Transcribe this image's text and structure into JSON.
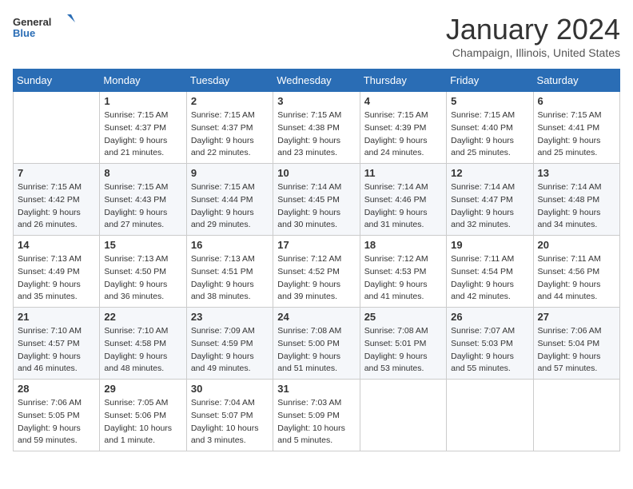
{
  "logo": {
    "general": "General",
    "blue": "Blue"
  },
  "title": "January 2024",
  "location": "Champaign, Illinois, United States",
  "headers": [
    "Sunday",
    "Monday",
    "Tuesday",
    "Wednesday",
    "Thursday",
    "Friday",
    "Saturday"
  ],
  "weeks": [
    [
      {
        "day": "",
        "sunrise": "",
        "sunset": "",
        "daylight": ""
      },
      {
        "day": "1",
        "sunrise": "Sunrise: 7:15 AM",
        "sunset": "Sunset: 4:37 PM",
        "daylight": "Daylight: 9 hours and 21 minutes."
      },
      {
        "day": "2",
        "sunrise": "Sunrise: 7:15 AM",
        "sunset": "Sunset: 4:37 PM",
        "daylight": "Daylight: 9 hours and 22 minutes."
      },
      {
        "day": "3",
        "sunrise": "Sunrise: 7:15 AM",
        "sunset": "Sunset: 4:38 PM",
        "daylight": "Daylight: 9 hours and 23 minutes."
      },
      {
        "day": "4",
        "sunrise": "Sunrise: 7:15 AM",
        "sunset": "Sunset: 4:39 PM",
        "daylight": "Daylight: 9 hours and 24 minutes."
      },
      {
        "day": "5",
        "sunrise": "Sunrise: 7:15 AM",
        "sunset": "Sunset: 4:40 PM",
        "daylight": "Daylight: 9 hours and 25 minutes."
      },
      {
        "day": "6",
        "sunrise": "Sunrise: 7:15 AM",
        "sunset": "Sunset: 4:41 PM",
        "daylight": "Daylight: 9 hours and 25 minutes."
      }
    ],
    [
      {
        "day": "7",
        "sunrise": "Sunrise: 7:15 AM",
        "sunset": "Sunset: 4:42 PM",
        "daylight": "Daylight: 9 hours and 26 minutes."
      },
      {
        "day": "8",
        "sunrise": "Sunrise: 7:15 AM",
        "sunset": "Sunset: 4:43 PM",
        "daylight": "Daylight: 9 hours and 27 minutes."
      },
      {
        "day": "9",
        "sunrise": "Sunrise: 7:15 AM",
        "sunset": "Sunset: 4:44 PM",
        "daylight": "Daylight: 9 hours and 29 minutes."
      },
      {
        "day": "10",
        "sunrise": "Sunrise: 7:14 AM",
        "sunset": "Sunset: 4:45 PM",
        "daylight": "Daylight: 9 hours and 30 minutes."
      },
      {
        "day": "11",
        "sunrise": "Sunrise: 7:14 AM",
        "sunset": "Sunset: 4:46 PM",
        "daylight": "Daylight: 9 hours and 31 minutes."
      },
      {
        "day": "12",
        "sunrise": "Sunrise: 7:14 AM",
        "sunset": "Sunset: 4:47 PM",
        "daylight": "Daylight: 9 hours and 32 minutes."
      },
      {
        "day": "13",
        "sunrise": "Sunrise: 7:14 AM",
        "sunset": "Sunset: 4:48 PM",
        "daylight": "Daylight: 9 hours and 34 minutes."
      }
    ],
    [
      {
        "day": "14",
        "sunrise": "Sunrise: 7:13 AM",
        "sunset": "Sunset: 4:49 PM",
        "daylight": "Daylight: 9 hours and 35 minutes."
      },
      {
        "day": "15",
        "sunrise": "Sunrise: 7:13 AM",
        "sunset": "Sunset: 4:50 PM",
        "daylight": "Daylight: 9 hours and 36 minutes."
      },
      {
        "day": "16",
        "sunrise": "Sunrise: 7:13 AM",
        "sunset": "Sunset: 4:51 PM",
        "daylight": "Daylight: 9 hours and 38 minutes."
      },
      {
        "day": "17",
        "sunrise": "Sunrise: 7:12 AM",
        "sunset": "Sunset: 4:52 PM",
        "daylight": "Daylight: 9 hours and 39 minutes."
      },
      {
        "day": "18",
        "sunrise": "Sunrise: 7:12 AM",
        "sunset": "Sunset: 4:53 PM",
        "daylight": "Daylight: 9 hours and 41 minutes."
      },
      {
        "day": "19",
        "sunrise": "Sunrise: 7:11 AM",
        "sunset": "Sunset: 4:54 PM",
        "daylight": "Daylight: 9 hours and 42 minutes."
      },
      {
        "day": "20",
        "sunrise": "Sunrise: 7:11 AM",
        "sunset": "Sunset: 4:56 PM",
        "daylight": "Daylight: 9 hours and 44 minutes."
      }
    ],
    [
      {
        "day": "21",
        "sunrise": "Sunrise: 7:10 AM",
        "sunset": "Sunset: 4:57 PM",
        "daylight": "Daylight: 9 hours and 46 minutes."
      },
      {
        "day": "22",
        "sunrise": "Sunrise: 7:10 AM",
        "sunset": "Sunset: 4:58 PM",
        "daylight": "Daylight: 9 hours and 48 minutes."
      },
      {
        "day": "23",
        "sunrise": "Sunrise: 7:09 AM",
        "sunset": "Sunset: 4:59 PM",
        "daylight": "Daylight: 9 hours and 49 minutes."
      },
      {
        "day": "24",
        "sunrise": "Sunrise: 7:08 AM",
        "sunset": "Sunset: 5:00 PM",
        "daylight": "Daylight: 9 hours and 51 minutes."
      },
      {
        "day": "25",
        "sunrise": "Sunrise: 7:08 AM",
        "sunset": "Sunset: 5:01 PM",
        "daylight": "Daylight: 9 hours and 53 minutes."
      },
      {
        "day": "26",
        "sunrise": "Sunrise: 7:07 AM",
        "sunset": "Sunset: 5:03 PM",
        "daylight": "Daylight: 9 hours and 55 minutes."
      },
      {
        "day": "27",
        "sunrise": "Sunrise: 7:06 AM",
        "sunset": "Sunset: 5:04 PM",
        "daylight": "Daylight: 9 hours and 57 minutes."
      }
    ],
    [
      {
        "day": "28",
        "sunrise": "Sunrise: 7:06 AM",
        "sunset": "Sunset: 5:05 PM",
        "daylight": "Daylight: 9 hours and 59 minutes."
      },
      {
        "day": "29",
        "sunrise": "Sunrise: 7:05 AM",
        "sunset": "Sunset: 5:06 PM",
        "daylight": "Daylight: 10 hours and 1 minute."
      },
      {
        "day": "30",
        "sunrise": "Sunrise: 7:04 AM",
        "sunset": "Sunset: 5:07 PM",
        "daylight": "Daylight: 10 hours and 3 minutes."
      },
      {
        "day": "31",
        "sunrise": "Sunrise: 7:03 AM",
        "sunset": "Sunset: 5:09 PM",
        "daylight": "Daylight: 10 hours and 5 minutes."
      },
      {
        "day": "",
        "sunrise": "",
        "sunset": "",
        "daylight": ""
      },
      {
        "day": "",
        "sunrise": "",
        "sunset": "",
        "daylight": ""
      },
      {
        "day": "",
        "sunrise": "",
        "sunset": "",
        "daylight": ""
      }
    ]
  ]
}
